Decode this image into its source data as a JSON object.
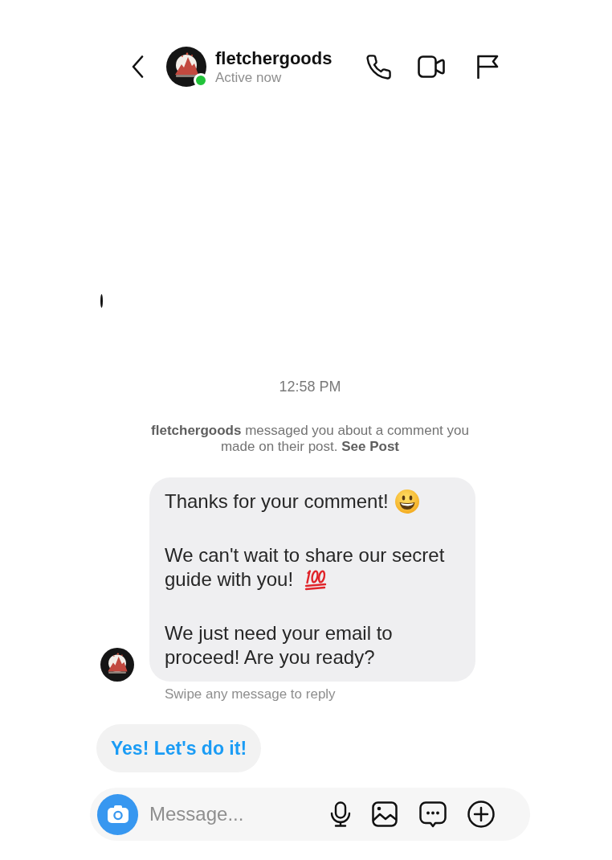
{
  "header": {
    "title": "fletchergoods",
    "status": "Active now",
    "online": true
  },
  "timestamp": "12:58 PM",
  "notice": {
    "text": "**fletchergoods** messaged you about a comment you made on their post.",
    "link": "See Post"
  },
  "message": {
    "paragraphs": [
      {
        "text": "Thanks for your comment!",
        "kind": "smiley"
      },
      {
        "text": "We can't wait to share our secret guide with you!",
        "kind": "hundred"
      },
      {
        "text": "We just need your email to proceed! Are you ready?",
        "kind": "plain"
      }
    ]
  },
  "hint": "Swipe any message to reply",
  "quick_replies": [
    {
      "label": "Yes! Let's do it!"
    }
  ],
  "composer": {
    "placeholder": "Message..."
  }
}
